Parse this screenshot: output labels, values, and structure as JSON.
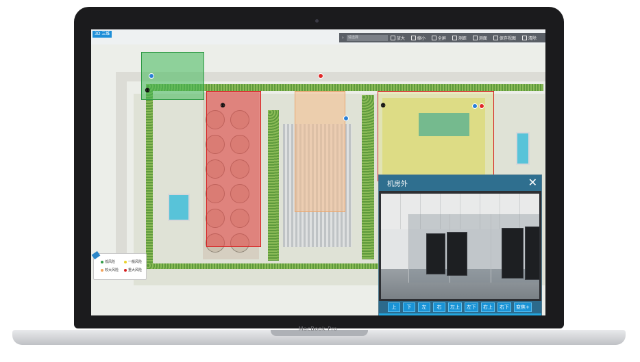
{
  "device": {
    "brand": "MacBook Pro"
  },
  "topbar": {
    "view_tag": "3D 三维"
  },
  "toolbar": {
    "arrow": "›",
    "select_placeholder": "请选择",
    "items": [
      "放大",
      "缩小",
      "全屏",
      "测距",
      "测面",
      "保存视图",
      "清除"
    ]
  },
  "legend": {
    "items": [
      {
        "label": "低风险",
        "color": "#2f9a46"
      },
      {
        "label": "一般风险",
        "color": "#e8d22c"
      },
      {
        "label": "较大风险",
        "color": "#f2a25a"
      },
      {
        "label": "重大风险",
        "color": "#d62020"
      }
    ]
  },
  "camera_popup": {
    "title": "机房外",
    "close": "✕",
    "controls": [
      "上",
      "下",
      "左",
      "右",
      "左上",
      "左下",
      "右上",
      "右下",
      "变焦+"
    ]
  },
  "colors": {
    "accent": "#1993d6",
    "header": "#2f6f8f"
  }
}
